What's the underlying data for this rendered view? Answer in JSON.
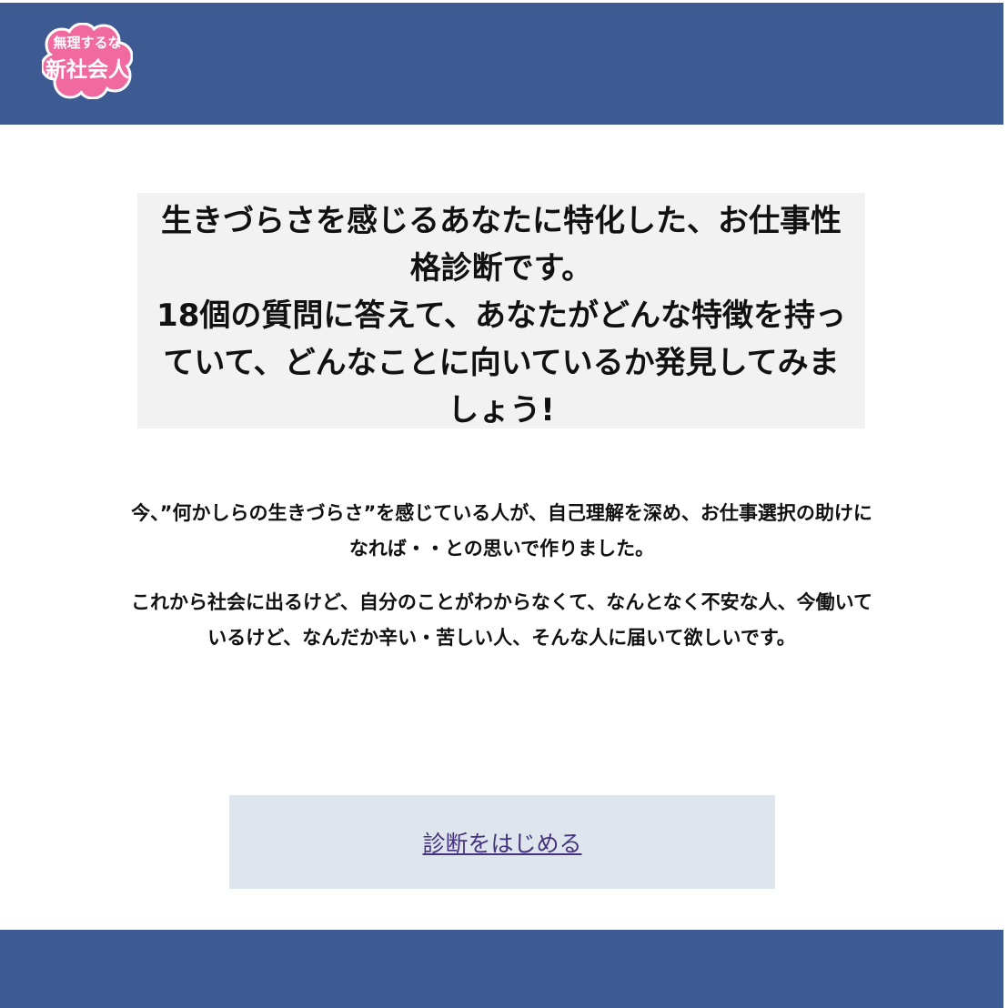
{
  "logo": {
    "line1": "無理するな",
    "line2": "新社会人",
    "bg_color": "#f06a9f"
  },
  "hero": {
    "line1": "生きづらさを感じるあなたに特化した、お仕事性",
    "line2": "格診断です。",
    "line3": "18個の質問に答えて、あなたがどんな特徴を持っ",
    "line4": "ていて、どんなことに向いているか発見してみま",
    "line5": "しょう!"
  },
  "intro": {
    "p1_line1": "今、”何かしらの生きづらさ”を感じている人が、自己理解を深め、お仕事選択の助けに",
    "p1_line2": "なれば・・との思いで作りました。",
    "p2_line1": "これから社会に出るけど、自分のことがわからなくて、なんとなく不安な人、今働いて",
    "p2_line2": "いるけど、なんだか辛い・苦しい人、そんな人に届いて欲しいです。"
  },
  "cta": {
    "label": "診断をはじめる",
    "link_color": "#46337d"
  },
  "colors": {
    "header": "#3d5b92",
    "footer": "#3d5b92",
    "hero_bg": "#f2f2f2",
    "cta_bg": "#dee5ec"
  }
}
